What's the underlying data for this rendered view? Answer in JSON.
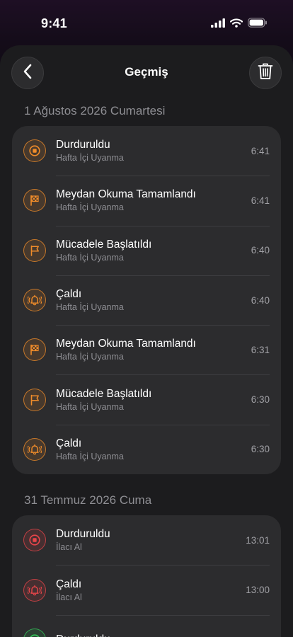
{
  "status_bar": {
    "time": "9:41"
  },
  "nav": {
    "title": "Geçmiş"
  },
  "colors": {
    "orange": "#f08c2a",
    "red": "#e8454a",
    "green": "#34c759"
  },
  "sections": [
    {
      "date": "1 Ağustos 2026 Cumartesi",
      "color": "#f08c2a",
      "entries": [
        {
          "icon": "stop-icon",
          "title": "Durduruldu",
          "alarm": "Hafta İçi Uyanma",
          "time": "6:41"
        },
        {
          "icon": "checkered-flag-icon",
          "title": "Meydan Okuma Tamamlandı",
          "alarm": "Hafta İçi Uyanma",
          "time": "6:41"
        },
        {
          "icon": "flag-icon",
          "title": "Mücadele Başlatıldı",
          "alarm": "Hafta İçi Uyanma",
          "time": "6:40"
        },
        {
          "icon": "ringing-bell-icon",
          "title": "Çaldı",
          "alarm": "Hafta İçi Uyanma",
          "time": "6:40"
        },
        {
          "icon": "checkered-flag-icon",
          "title": "Meydan Okuma Tamamlandı",
          "alarm": "Hafta İçi Uyanma",
          "time": "6:31"
        },
        {
          "icon": "flag-icon",
          "title": "Mücadele Başlatıldı",
          "alarm": "Hafta İçi Uyanma",
          "time": "6:30"
        },
        {
          "icon": "ringing-bell-icon",
          "title": "Çaldı",
          "alarm": "Hafta İçi Uyanma",
          "time": "6:30"
        }
      ]
    },
    {
      "date": "31 Temmuz 2026 Cuma",
      "entries": [
        {
          "icon": "stop-icon",
          "color": "#e8454a",
          "title": "Durduruldu",
          "alarm": "İlacı Al",
          "time": "13:01"
        },
        {
          "icon": "ringing-bell-icon",
          "color": "#e8454a",
          "title": "Çaldı",
          "alarm": "İlacı Al",
          "time": "13:00"
        },
        {
          "icon": "stop-icon",
          "color": "#34c759",
          "title": "Durduruldu",
          "alarm": "",
          "time": ""
        }
      ]
    }
  ]
}
